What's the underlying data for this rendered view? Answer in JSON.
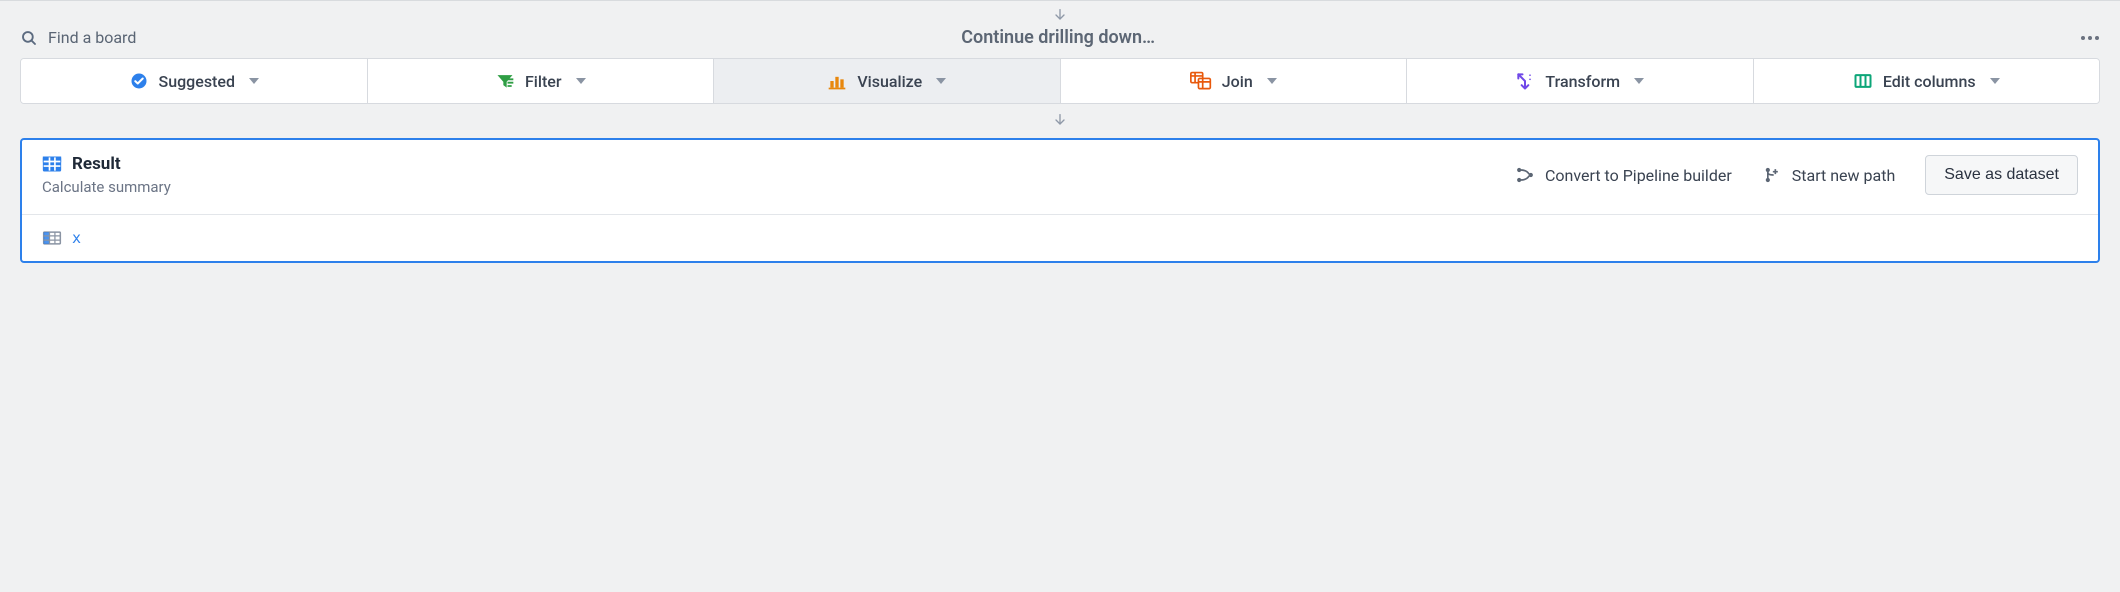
{
  "header": {
    "search_placeholder": "Find a board",
    "title": "Continue drilling down…"
  },
  "actions": {
    "suggested": "Suggested",
    "filter": "Filter",
    "visualize": "Visualize",
    "join": "Join",
    "transform": "Transform",
    "edit_columns": "Edit columns"
  },
  "result": {
    "title": "Result",
    "subtitle": "Calculate summary",
    "convert": "Convert to Pipeline builder",
    "start_path": "Start new path",
    "save": "Save as dataset",
    "column": "x"
  }
}
